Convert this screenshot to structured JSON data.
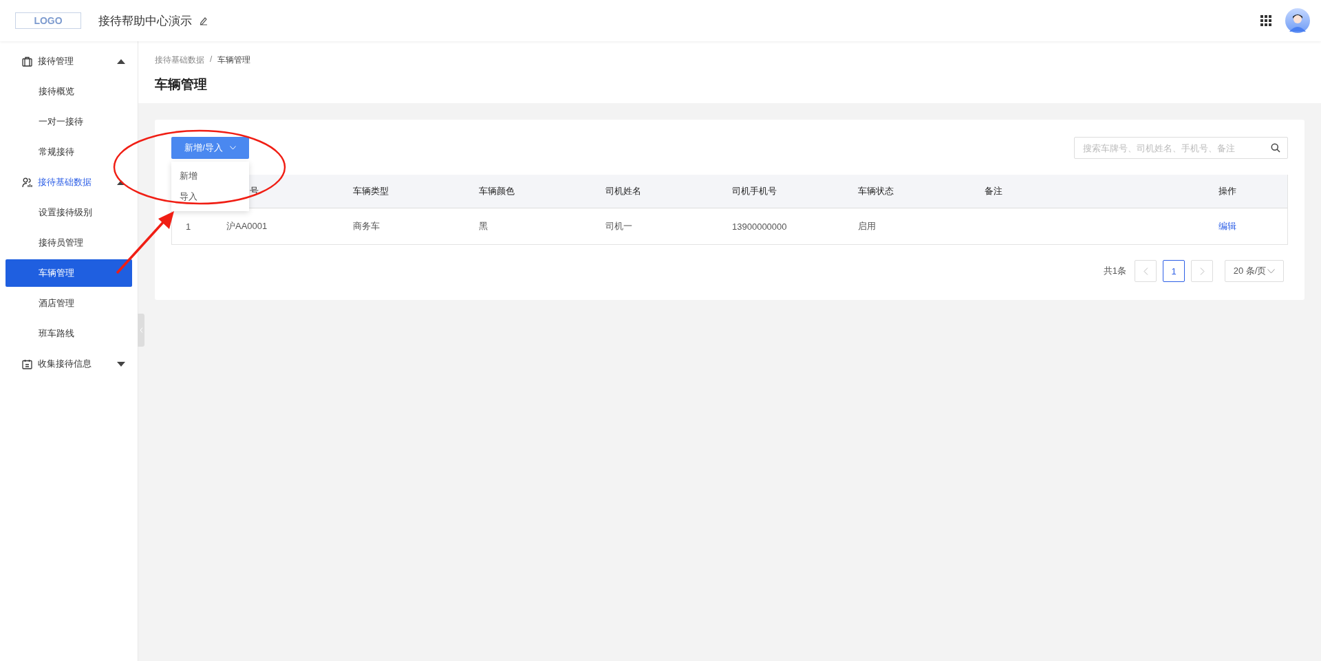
{
  "header": {
    "logo": "LOGO",
    "title": "接待帮助中心演示"
  },
  "sidebar": {
    "groups": [
      {
        "label": "接待管理",
        "kind": "briefcase",
        "expanded": true,
        "selected": false,
        "children": [
          {
            "label": "接待概览",
            "selected": false
          },
          {
            "label": "一对一接待",
            "selected": false
          },
          {
            "label": "常规接待",
            "selected": false
          }
        ]
      },
      {
        "label": "接待基础数据",
        "kind": "people",
        "expanded": true,
        "selected": true,
        "children": [
          {
            "label": "设置接待级别",
            "selected": false
          },
          {
            "label": "接待员管理",
            "selected": false
          },
          {
            "label": "车辆管理",
            "selected": true
          },
          {
            "label": "酒店管理",
            "selected": false
          },
          {
            "label": "班车路线",
            "selected": false
          }
        ]
      },
      {
        "label": "收集接待信息",
        "kind": "calendar",
        "expanded": false,
        "selected": false
      }
    ]
  },
  "breadcrumb": {
    "items": [
      "接待基础数据",
      "车辆管理"
    ],
    "separator": "/"
  },
  "page_title": "车辆管理",
  "toolbar": {
    "button": "新增/导入",
    "dropdown": {
      "open": true,
      "items": [
        "新增",
        "导入"
      ]
    },
    "search": {
      "placeholder": "搜索车牌号、司机姓名、手机号、备注"
    }
  },
  "table": {
    "columns": [
      "号",
      "车辆类型",
      "车辆颜色",
      "司机姓名",
      "司机手机号",
      "车辆状态",
      "备注",
      "操作"
    ],
    "rows": [
      {
        "index": "1",
        "plate": "沪AA0001",
        "type": "商务车",
        "vehicle_color": "黑",
        "driver": "司机一",
        "phone": "13900000000",
        "status": "启用",
        "action": "编辑"
      }
    ]
  },
  "pagination": {
    "total": "共1条",
    "pages": [
      {
        "label": "1",
        "selected": true
      }
    ],
    "page_size": "20 条/页"
  }
}
